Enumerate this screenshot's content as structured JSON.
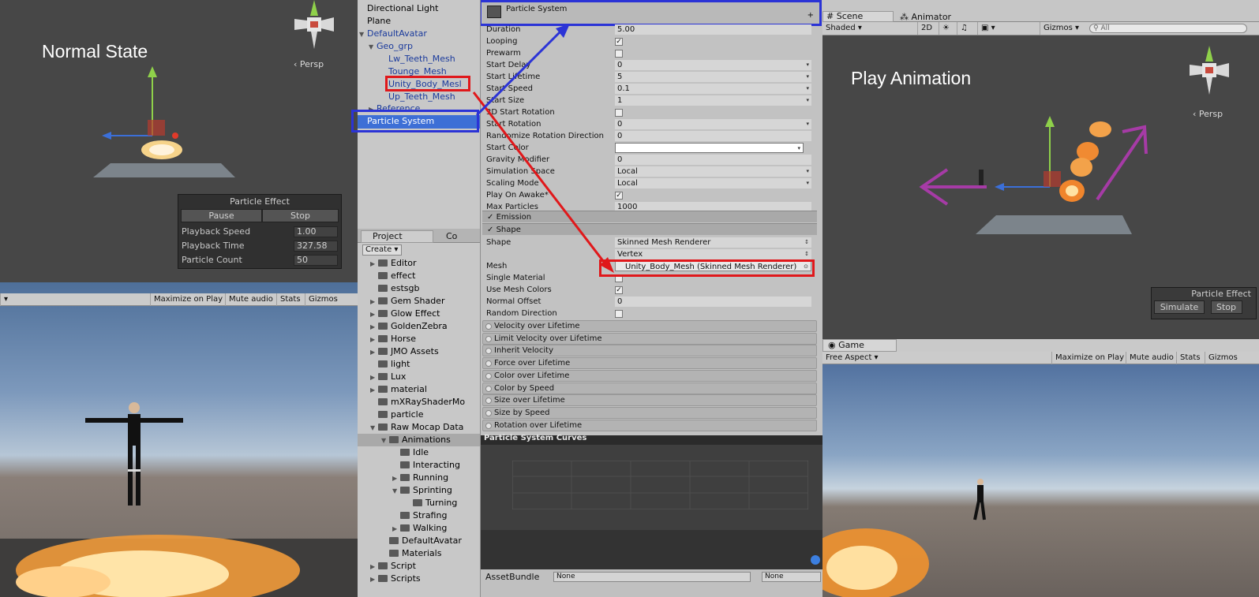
{
  "scene_left": {
    "title": "Normal State",
    "persp": "‹ Persp",
    "particle_effect": {
      "title": "Particle Effect",
      "pause": "Pause",
      "stop": "Stop",
      "rows": [
        {
          "label": "Playback Speed",
          "value": "1.00"
        },
        {
          "label": "Playback Time",
          "value": "327.58"
        },
        {
          "label": "Particle Count",
          "value": "50"
        }
      ]
    }
  },
  "game_left": {
    "toolbar": [
      "Maximize on Play",
      "Mute audio",
      "Stats",
      "Gizmos"
    ]
  },
  "hierarchy": {
    "items": [
      "Directional Light",
      "Plane",
      "DefaultAvatar",
      "Geo_grp",
      "Lw_Teeth_Mesh",
      "Tounge_Mesh",
      "Unity_Body_Mesl",
      "Up_Teeth_Mesh",
      "Reference",
      "Particle System"
    ]
  },
  "project": {
    "tabs": [
      "Project",
      "Co"
    ],
    "create": "Create",
    "items": [
      "Editor",
      "effect",
      "estsgb",
      "Gem Shader",
      "Glow Effect",
      "GoldenZebra",
      "Horse",
      "JMO Assets",
      "light",
      "Lux",
      "material",
      "mXRayShaderMo",
      "particle",
      "Raw Mocap Data",
      "Animations",
      "Idle",
      "Interacting",
      "Running",
      "Sprinting",
      "Turning",
      "Strafing",
      "Walking",
      "DefaultAvatar",
      "Materials",
      "Script",
      "Scripts"
    ]
  },
  "inspector": {
    "header": "Particle System",
    "rows": [
      {
        "label": "Duration",
        "value": "5.00"
      },
      {
        "label": "Looping",
        "check": "✓"
      },
      {
        "label": "Prewarm",
        "check": ""
      },
      {
        "label": "Start Delay",
        "value": "0"
      },
      {
        "label": "Start Lifetime",
        "value": "5"
      },
      {
        "label": "Start Speed",
        "value": "0.1"
      },
      {
        "label": "Start Size",
        "value": "1"
      },
      {
        "label": "3D Start Rotation",
        "check": ""
      },
      {
        "label": "Start Rotation",
        "value": "0"
      },
      {
        "label": "Randomize Rotation Direction",
        "value": "0"
      },
      {
        "label": "Start Color",
        "value": ""
      },
      {
        "label": "Gravity Modifier",
        "value": "0"
      },
      {
        "label": "Simulation Space",
        "value": "Local"
      },
      {
        "label": "Scaling Mode",
        "value": "Local"
      },
      {
        "label": "Play On Awake*",
        "check": "✓"
      },
      {
        "label": "Max Particles",
        "value": "1000"
      }
    ],
    "emission": "Emission",
    "shape": "Shape",
    "shape_rows": [
      {
        "label": "Shape",
        "value": "Skinned Mesh Renderer"
      },
      {
        "label": "",
        "value": "Vertex"
      },
      {
        "label": "Mesh",
        "value": "Unity_Body_Mesh (Skinned Mesh Renderer)"
      },
      {
        "label": "Single Material",
        "check": ""
      },
      {
        "label": "Use Mesh Colors",
        "check": "✓"
      },
      {
        "label": "Normal Offset",
        "value": "0"
      },
      {
        "label": "Random Direction",
        "check": ""
      }
    ],
    "modules": [
      "Velocity over Lifetime",
      "Limit Velocity over Lifetime",
      "Inherit Velocity",
      "Force over Lifetime",
      "Color over Lifetime",
      "Color by Speed",
      "Size over Lifetime",
      "Size by Speed",
      "Rotation over Lifetime"
    ]
  },
  "curves": {
    "title": "Particle System Curves",
    "assetbundle_label": "AssetBundle",
    "none1": "None",
    "none2": "None"
  },
  "scene_right": {
    "tabs": [
      "Scene",
      "Animator"
    ],
    "shaded": "Shaded",
    "twod": "2D",
    "gizmos": "Gizmos",
    "search_placeholder": "All",
    "title": "Play Animation",
    "persp": "‹ Persp",
    "particle_effect": {
      "title": "Particle Effect",
      "simulate": "Simulate",
      "stop": "Stop"
    }
  },
  "game_right": {
    "tab": "Game",
    "aspect": "Free Aspect",
    "toolbar": [
      "Maximize on Play",
      "Mute audio",
      "Stats",
      "Gizmos"
    ]
  }
}
